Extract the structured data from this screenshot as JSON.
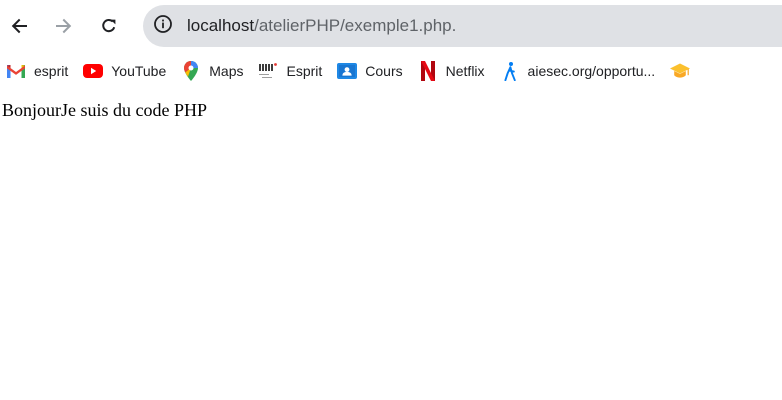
{
  "browser": {
    "url_host": "localhost",
    "url_path": "/atelierPHP/exemple1.php.",
    "back_icon": "arrow-left",
    "forward_icon": "arrow-right",
    "reload_icon": "reload",
    "site_info_icon": "info-circle"
  },
  "bookmarks": [
    {
      "label": "esprit",
      "icon": "gmail"
    },
    {
      "label": "YouTube",
      "icon": "youtube"
    },
    {
      "label": "Maps",
      "icon": "maps-pin"
    },
    {
      "label": "Esprit",
      "icon": "esprit-logo"
    },
    {
      "label": "Cours",
      "icon": "classroom"
    },
    {
      "label": "Netflix",
      "icon": "netflix"
    },
    {
      "label": "aiesec.org/opportu...",
      "icon": "aiesec"
    },
    {
      "label": "",
      "icon": "graduation-cap"
    }
  ],
  "page": {
    "text": "BonjourJe suis du code PHP"
  },
  "colors": {
    "omnibox_bg": "#dfe1e5",
    "icon_dark": "#202124",
    "icon_disabled": "#9aa0a6",
    "youtube_red": "#ff0000",
    "netflix_red": "#e50914",
    "classroom_blue": "#1e88e5",
    "aiesec_blue": "#037ef3"
  }
}
